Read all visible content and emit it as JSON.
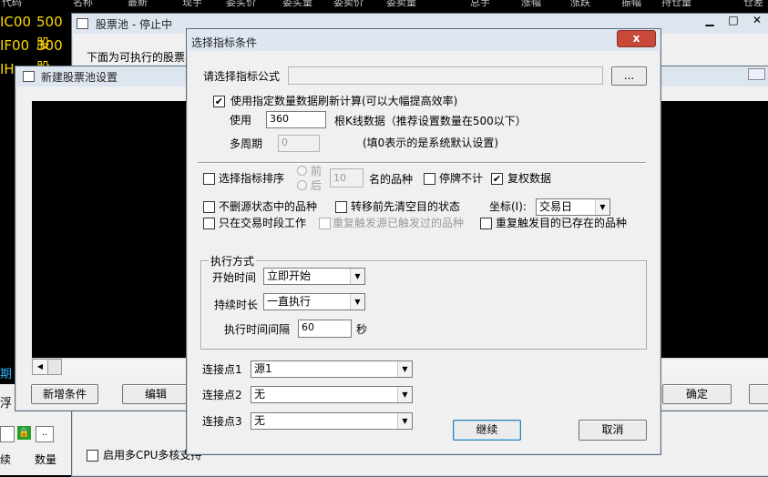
{
  "background": {
    "table_headers": [
      "代码",
      "名称",
      "最新",
      "现手",
      "委买价",
      "委买量",
      "委卖价",
      "委卖量",
      "总手",
      "涨幅",
      "涨跌",
      "振幅",
      "持仓量",
      "仓差"
    ],
    "codes": [
      "IC00",
      "IF00",
      "IH"
    ],
    "names": [
      "500股",
      "300股"
    ],
    "left_fragments": [
      "期",
      "浮",
      "续"
    ],
    "volume_label": "数量",
    "colors": {
      "code": "#ffd800"
    }
  },
  "pool_window": {
    "title": "股票池 - 停止中",
    "subtitle": "下面为可执行的股票",
    "bottom_text": "启用多CPU多核支持"
  },
  "new_pool_window": {
    "title": "新建股票池设置",
    "add_condition": "新增条件",
    "edit": "编辑",
    "ok": "确定"
  },
  "dialog": {
    "title": "选择指标条件",
    "formula_label": "请选择指标公式",
    "browse_label": "...",
    "use_count_check": "使用指定数量数据刷新计算(可以大幅提高效率)",
    "use_count_checked": "✔",
    "use_label": "使用",
    "use_value": "360",
    "use_hint": "根K线数据（推荐设置数量在500以下）",
    "multi_period_label": "多周期",
    "multi_period_value": "0",
    "multi_period_hint": "(填0表示的是系统默认设置)",
    "sort_check": "选择指标排序",
    "front_label": "前",
    "back_label": "后",
    "sort_value": "10",
    "sort_suffix": "名的品种",
    "suspend_check": "停牌不计",
    "adjust_check": "复权数据",
    "adjust_checked": "✔",
    "keep_source_check": "不删源状态中的品种",
    "clear_target_check": "转移前先清空目的状态",
    "axis_label": "坐标(I):",
    "axis_value": "交易日",
    "trade_only_check": "只在交易时段工作",
    "repeat_source_check": "重复触发源已触发过的品种",
    "repeat_target_check": "重复触发目的已存在的品种",
    "exec_group": "执行方式",
    "start_time_label": "开始时间",
    "start_time_value": "立即开始",
    "duration_label": "持续时长",
    "duration_value": "一直执行",
    "interval_label": "执行时间间隔",
    "interval_value": "60",
    "interval_unit": "秒",
    "conn1_label": "连接点1",
    "conn1_value": "源1",
    "conn2_label": "连接点2",
    "conn2_value": "无",
    "conn3_label": "连接点3",
    "conn3_value": "无",
    "continue_label": "继续",
    "cancel_label": "取消",
    "close_symbol": "x"
  }
}
